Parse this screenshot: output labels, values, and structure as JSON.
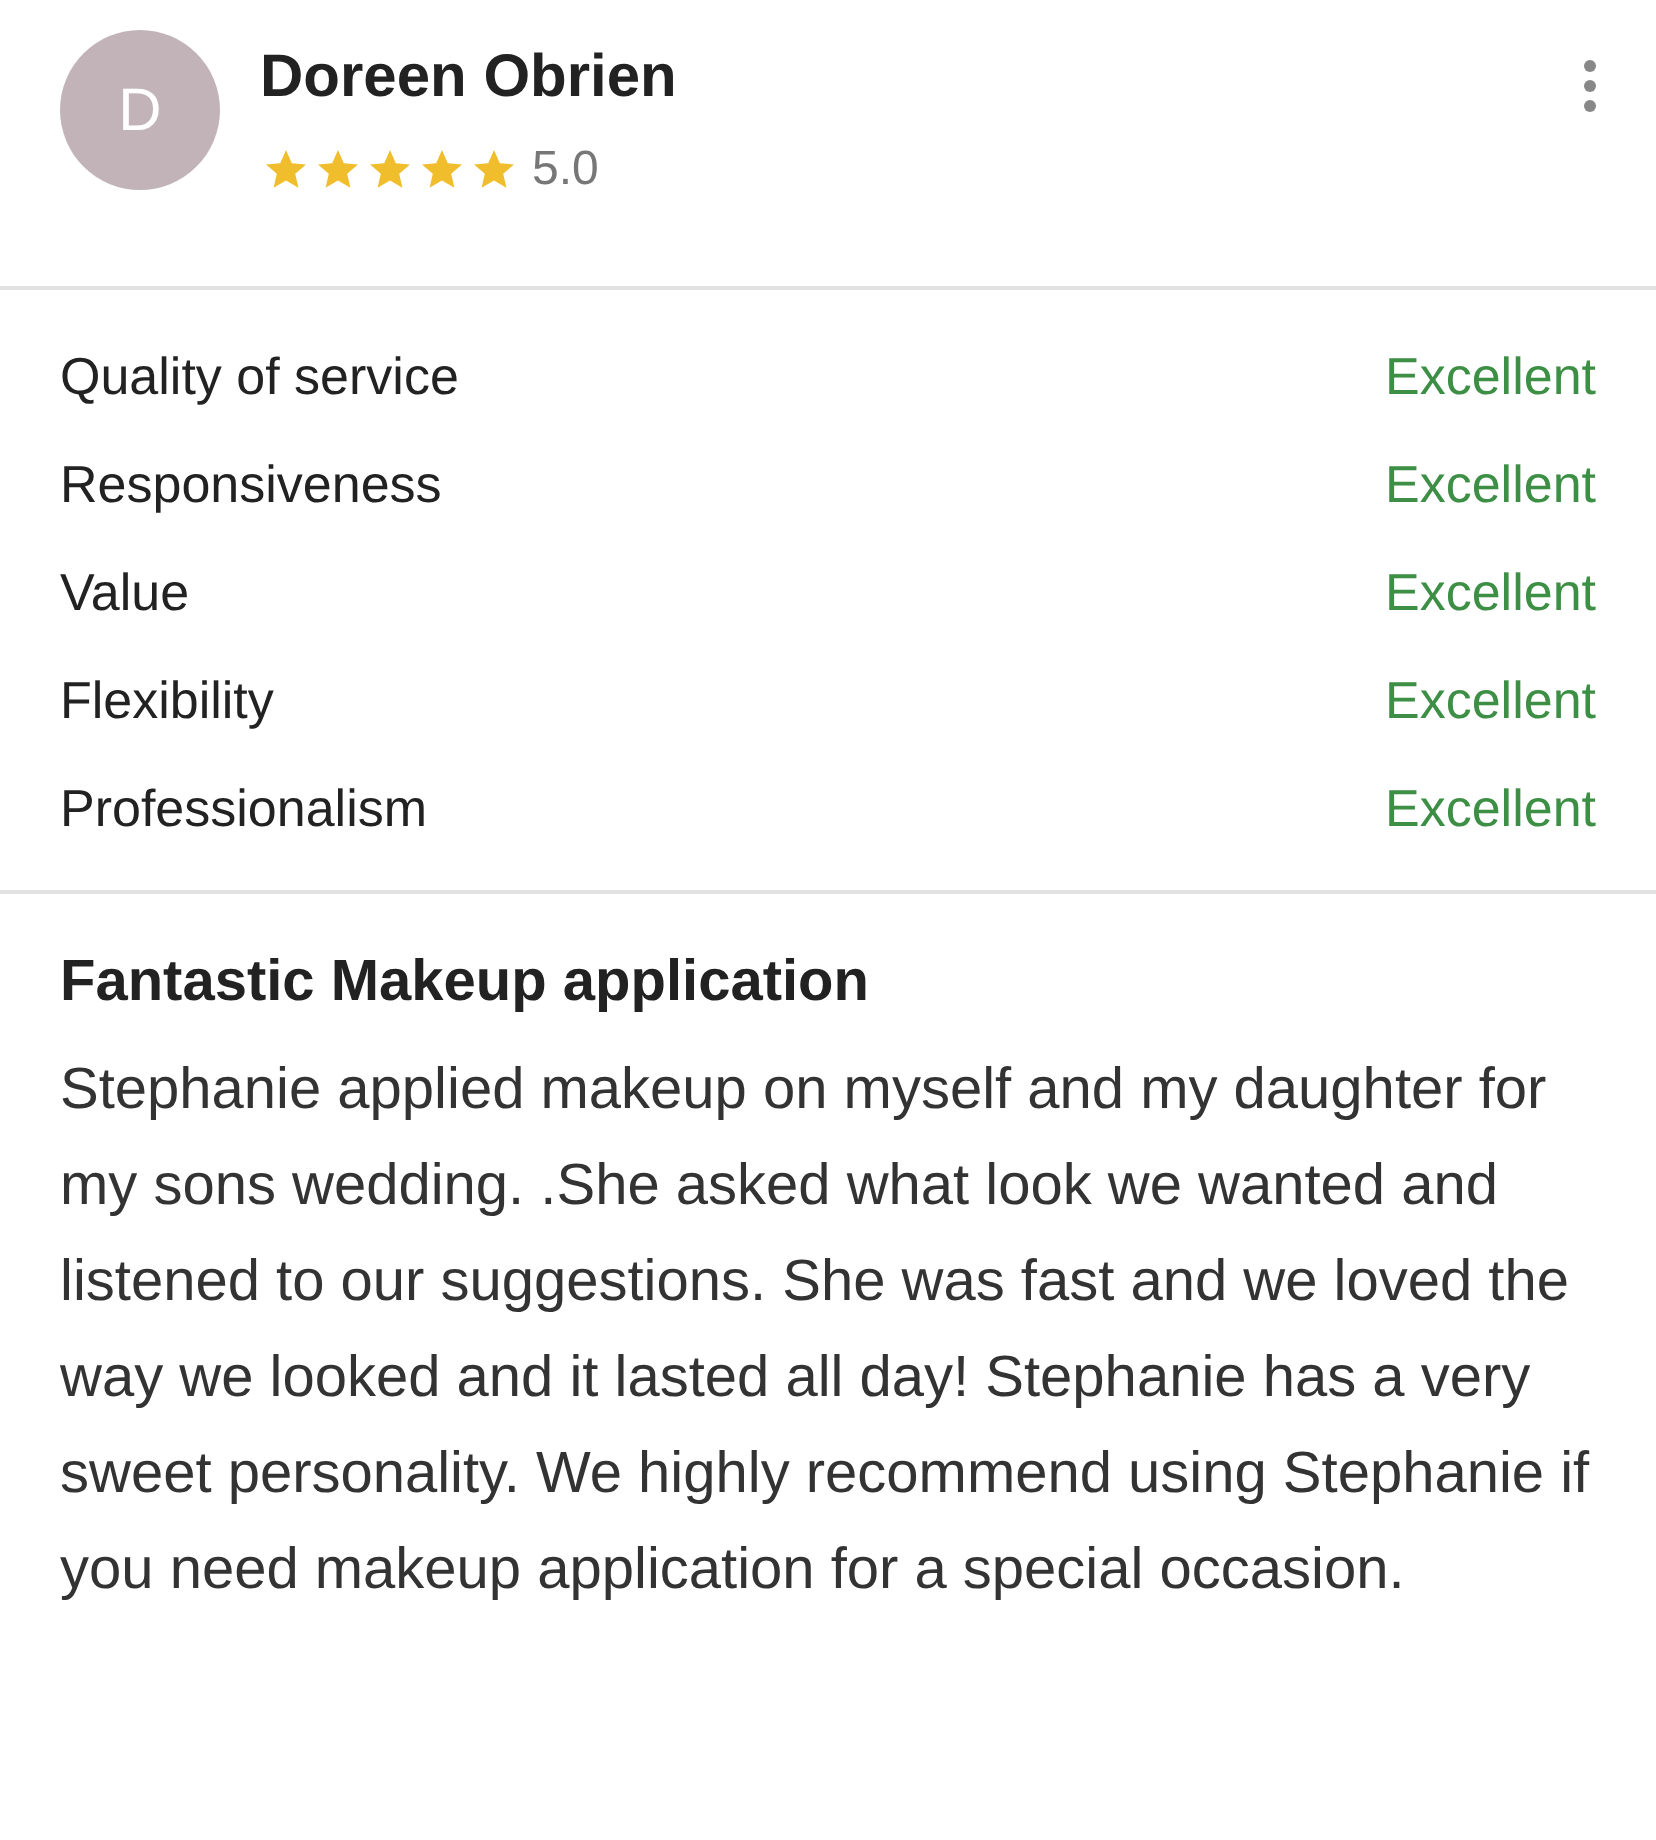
{
  "reviewer": {
    "initial": "D",
    "name": "Doreen Obrien",
    "stars": 5,
    "rating": "5.0"
  },
  "ratings": [
    {
      "label": "Quality of service",
      "value": "Excellent"
    },
    {
      "label": "Responsiveness",
      "value": "Excellent"
    },
    {
      "label": "Value",
      "value": "Excellent"
    },
    {
      "label": "Flexibility",
      "value": "Excellent"
    },
    {
      "label": "Professionalism",
      "value": "Excellent"
    }
  ],
  "review": {
    "title": "Fantastic Makeup application",
    "body": "Stephanie applied makeup on myself and my daughter for my sons wedding. .She asked what look we wanted and listened to our suggestions. She was fast and we loved the way we looked and it lasted all day! Stephanie has a very sweet personality. We highly recommend using Stephanie if you need makeup application for a special occasion."
  }
}
